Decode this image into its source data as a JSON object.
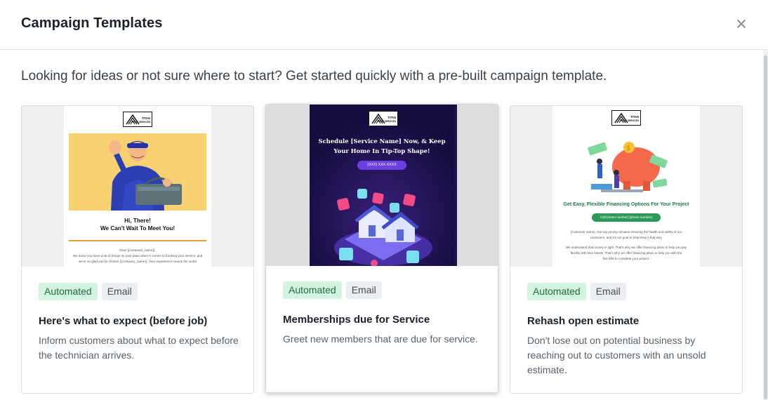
{
  "modal": {
    "title": "Campaign Templates",
    "intro": "Looking for ideas or not sure where to start? Get started quickly with a pre-built campaign template."
  },
  "icons": {
    "close": "close-icon"
  },
  "cards": [
    {
      "badges": [
        "Automated",
        "Email"
      ],
      "title": "Here's what to expect (before job)",
      "description": "Inform customers about what to expect before the technician arrives.",
      "preview": {
        "logo_line1": "TITAN",
        "logo_line2": "HOME SERVICES",
        "headline_1": "Hi, There!",
        "headline_2": "We Can't Wait To Meet You!",
        "body_1": "Dear {{customer_name}},",
        "body_2": "We know you have a lot of things on your plate when it comes to booking your service, and",
        "body_3": "we're so glad you've chosen {{company_name}}. Your experience means the world"
      }
    },
    {
      "badges": [
        "Automated",
        "Email"
      ],
      "title": "Memberships due for Service",
      "description": "Greet new members that are due for service.",
      "preview": {
        "logo_line1": "TITAN",
        "logo_line2": "HOME SERVICES",
        "headline": "Schedule [Service Name] Now, & Keep Your Home In Tip-Top Shape!",
        "phone": "(XXX) XXX-XXXX"
      }
    },
    {
      "badges": [
        "Automated",
        "Email"
      ],
      "title": "Rehash open estimate",
      "description": "Don't lose out on potential business by reaching out to customers with an unsold estimate.",
      "preview": {
        "logo_line1": "TITAN",
        "logo_line2": "HOME SERVICES",
        "headline": "Get Easy, Flexible Financing Options For Your Project",
        "cta": "Call [Insert number] (phone number)",
        "body_1": "{Customer name}, Our top priority remains ensuring the health and safety of our",
        "body_2": "customers, and it's our goal to help keep it that way.",
        "body_3": "We understand that money is tight. That's why we offer financing plans to help you pay",
        "body_4": "flexibly with less hassle. That's why we offer financing plans to help you with the",
        "body_5": "five bills to complete your project."
      }
    }
  ],
  "colors": {
    "badge_auto_bg": "#d3f4e0",
    "badge_auto_text": "#226a3f",
    "badge_email_bg": "#eceef1",
    "promo_bg": "#1a1350",
    "accent_purple": "#6b3fe0",
    "financing_green": "#2e9a5a"
  }
}
